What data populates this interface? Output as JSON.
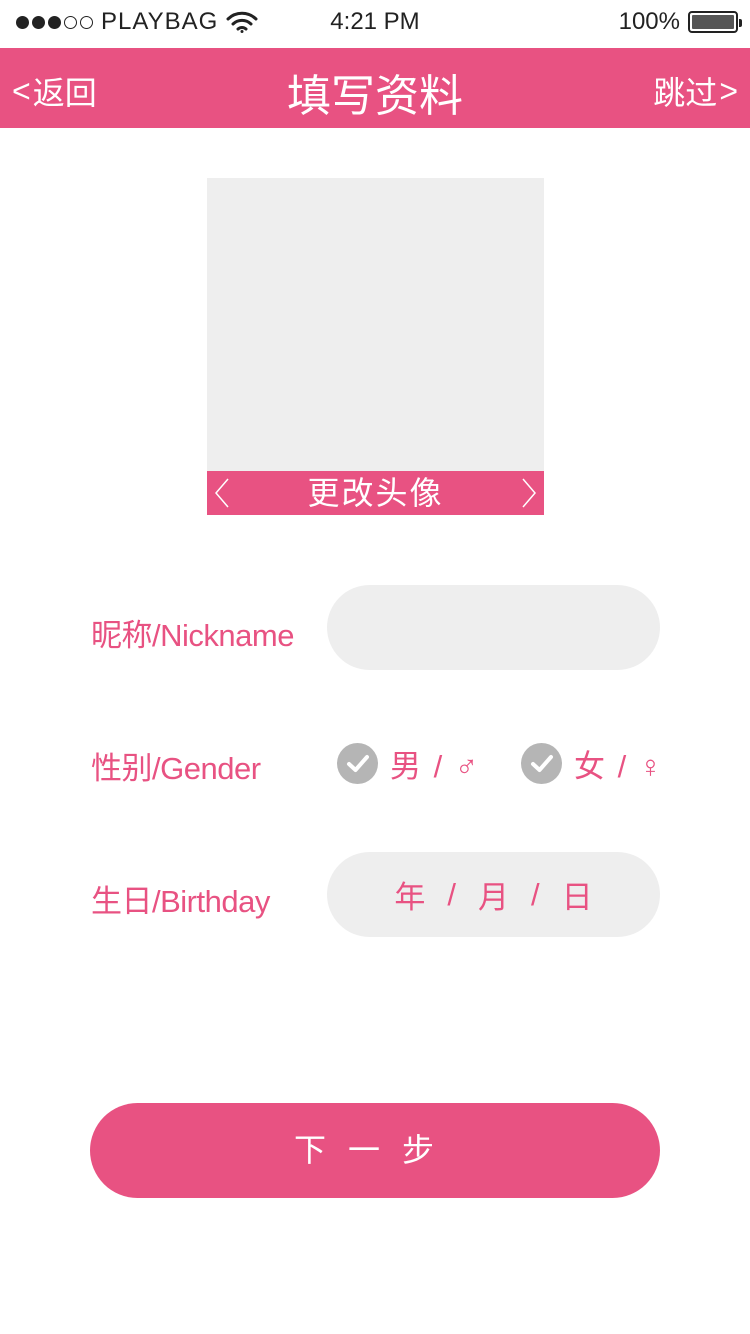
{
  "status_bar": {
    "carrier": "PLAYBAG",
    "time": "4:21 PM",
    "battery": "100%",
    "signal_dots_filled": 3,
    "signal_dots_total": 5
  },
  "nav": {
    "back_label": "返回",
    "title": "填写资料",
    "skip_label": "跳过"
  },
  "avatar": {
    "change_label": "更改头像"
  },
  "form": {
    "nickname_label": "昵称/Nickname",
    "nickname_value": "",
    "gender_label": "性别/Gender",
    "gender_male": "男 / ♂",
    "gender_female": "女 / ♀",
    "birthday_label": "生日/Birthday",
    "birthday_year": "年",
    "birthday_sep1": "/",
    "birthday_month": "月",
    "birthday_sep2": "/",
    "birthday_day": "日"
  },
  "next_button": "下一步",
  "colors": {
    "accent": "#e85282",
    "field_bg": "#eeeeee",
    "check_gray": "#b5b5b5"
  }
}
